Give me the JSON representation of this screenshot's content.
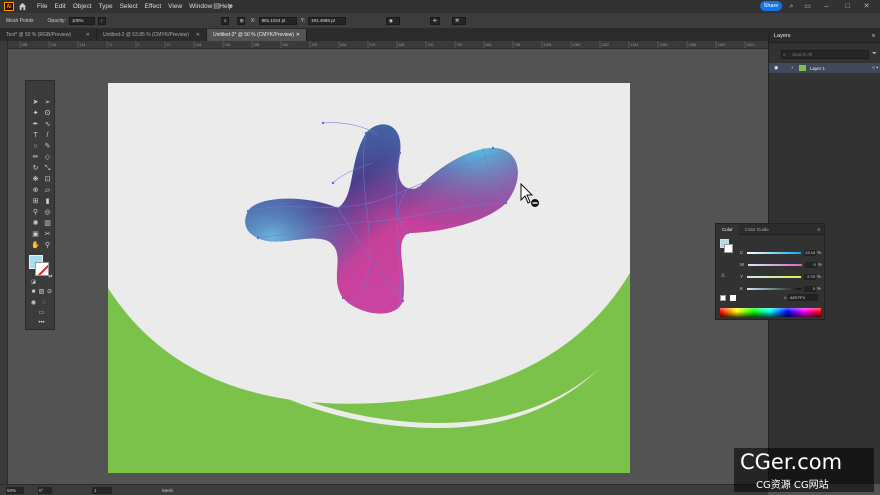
{
  "app": {
    "logo_text": "Ai"
  },
  "menu": [
    "File",
    "Edit",
    "Object",
    "Type",
    "Select",
    "Effect",
    "View",
    "Window",
    "Help"
  ],
  "share_label": "Share",
  "control_bar": {
    "tool_label": "Mesh Points",
    "opacity_label": "Opacity:",
    "opacity_value": "100%",
    "x_value": "881.1024 pt",
    "y_value": "191.4988 pt"
  },
  "tabs": [
    {
      "label": "Test* @ 50 % (RGB/Preview)",
      "active": false
    },
    {
      "label": "Untitled-2 @ 53.85 % (CMYK/Preview)",
      "active": false
    },
    {
      "label": "Untitled-3* @ 50 % (CMYK/Preview)",
      "active": true
    }
  ],
  "ruler_ticks": [
    "288",
    "216",
    "144",
    "72",
    "0",
    "72",
    "144",
    "216",
    "288",
    "360",
    "432",
    "504",
    "576",
    "648",
    "720",
    "792",
    "864",
    "936",
    "1008",
    "1080",
    "1152",
    "1224",
    "1296",
    "1368",
    "1440",
    "1512"
  ],
  "layers_panel": {
    "title": "Layers",
    "search_placeholder": "Search All",
    "layer_name": "Layer 1"
  },
  "color_panel": {
    "tabs": [
      "Color",
      "Color Guide"
    ],
    "channels": [
      {
        "label": "C",
        "value": "23.19",
        "unit": "%"
      },
      {
        "label": "M",
        "value": "0",
        "unit": "%"
      },
      {
        "label": "Y",
        "value": "2.75",
        "unit": "%"
      },
      {
        "label": "K",
        "value": "0",
        "unit": "%"
      }
    ],
    "hex_value": "AFE7F3"
  },
  "status_bar": {
    "zoom": "50%",
    "angle": "0°",
    "artboard": "1",
    "tool": "Mesh"
  },
  "watermark": {
    "brand": "CGer.com",
    "tagline": "CG资源 CG网站"
  },
  "colors": {
    "fill": "#a8dcef",
    "green": "#7bc24b",
    "accent": "#1473e6"
  }
}
